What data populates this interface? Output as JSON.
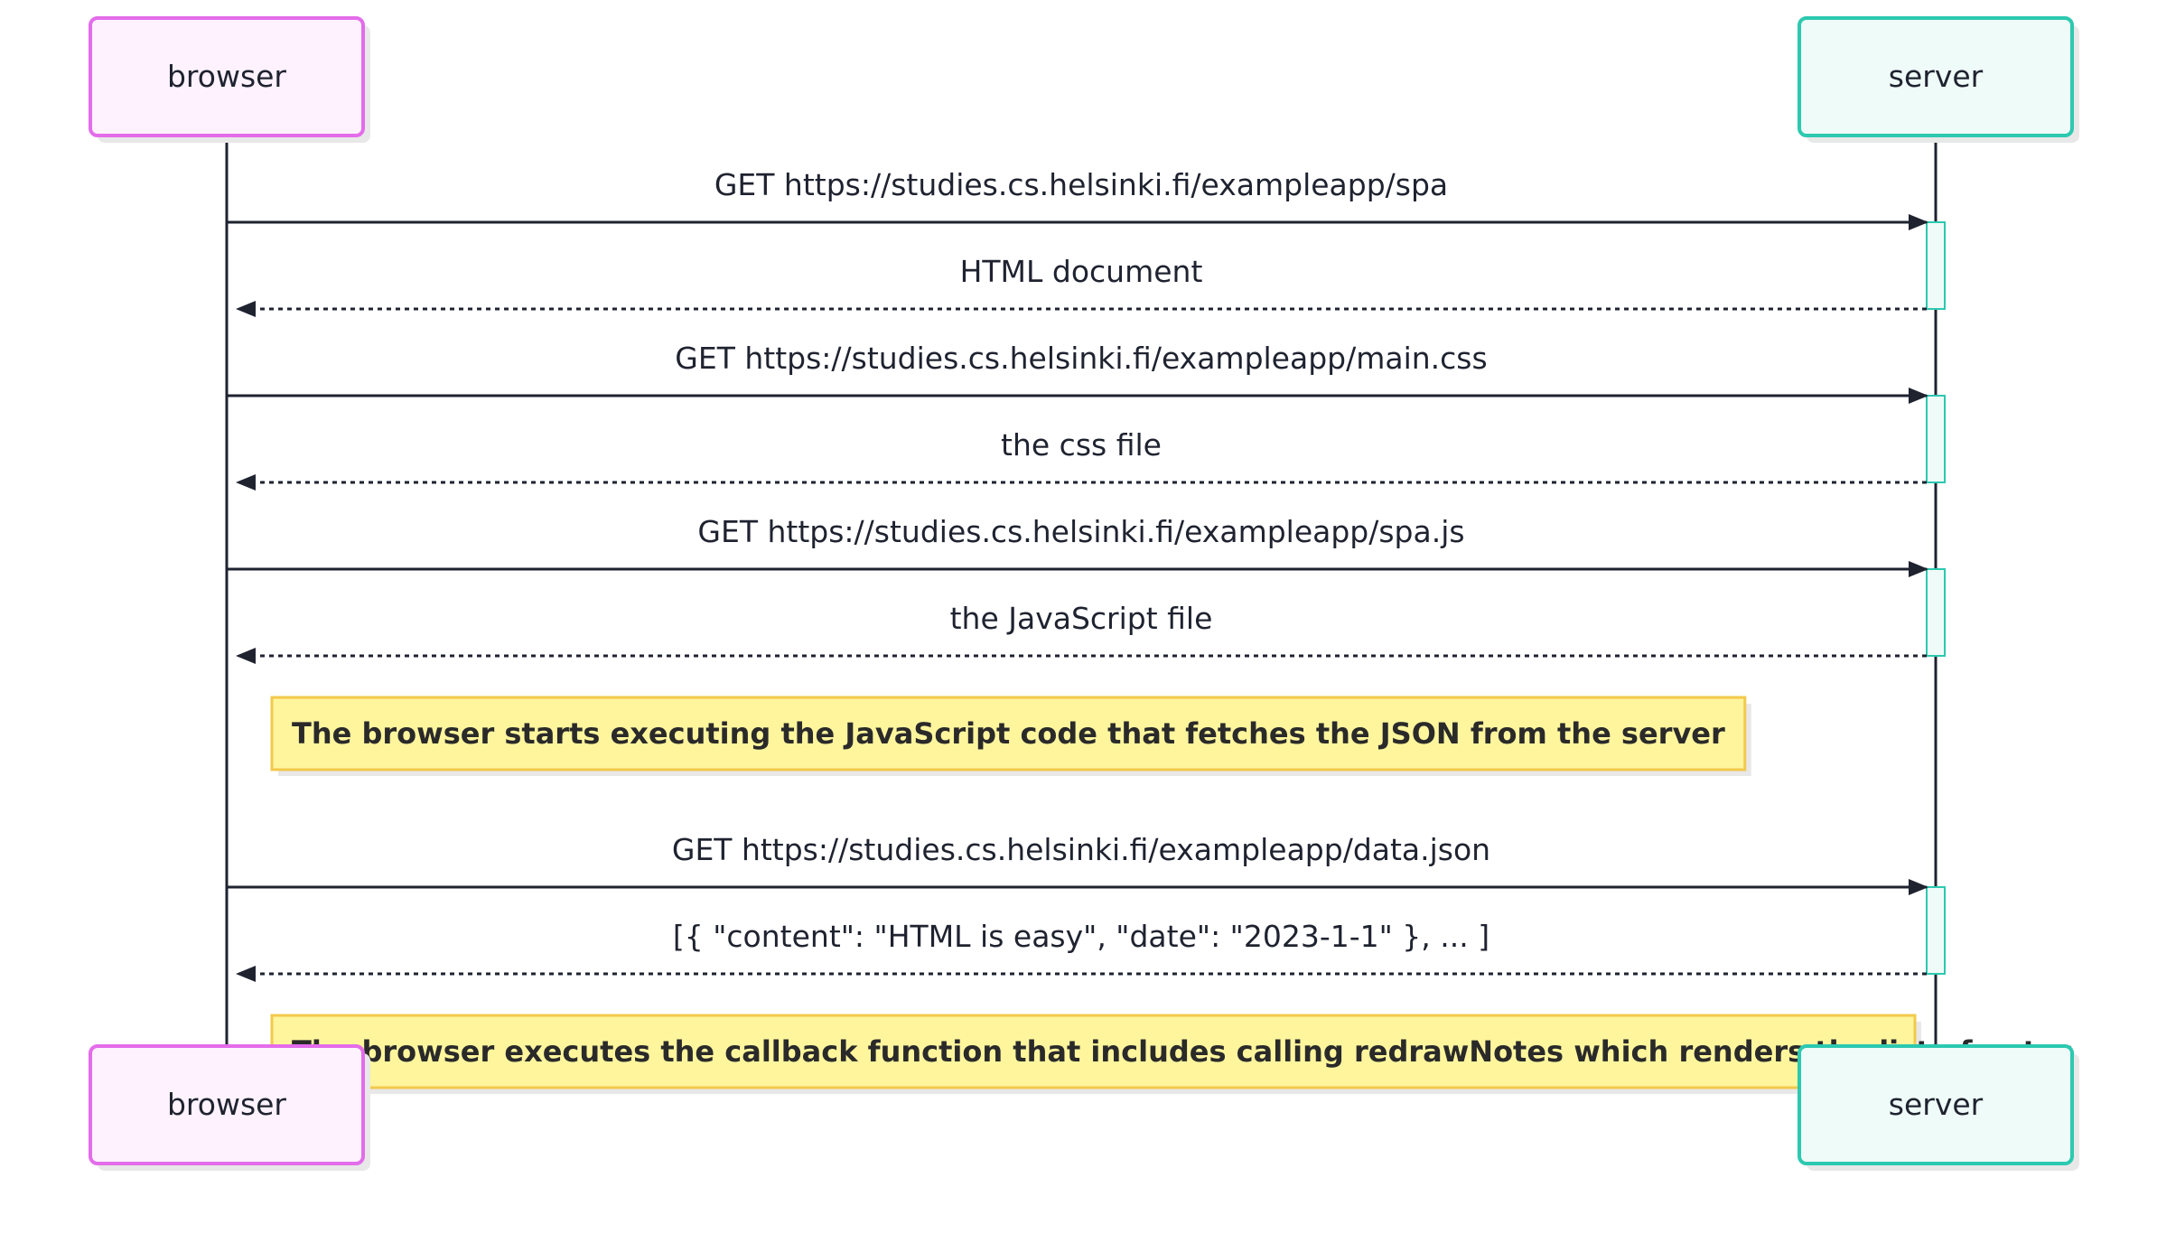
{
  "participants": [
    {
      "id": "browser",
      "label": "browser",
      "stroke": "#e36cea",
      "fill": "#fdf2fd"
    },
    {
      "id": "server",
      "label": "server",
      "stroke": "#2cc9b0",
      "fill": "#effbf8"
    }
  ],
  "steps": [
    {
      "kind": "message",
      "from": "browser",
      "to": "server",
      "style": "solid",
      "text": "GET https://studies.cs.helsinki.fi/exampleapp/spa"
    },
    {
      "kind": "message",
      "from": "server",
      "to": "browser",
      "style": "dotted",
      "text": "HTML document"
    },
    {
      "kind": "message",
      "from": "browser",
      "to": "server",
      "style": "solid",
      "text": "GET https://studies.cs.helsinki.fi/exampleapp/main.css"
    },
    {
      "kind": "message",
      "from": "server",
      "to": "browser",
      "style": "dotted",
      "text": "the css file"
    },
    {
      "kind": "message",
      "from": "browser",
      "to": "server",
      "style": "solid",
      "text": "GET https://studies.cs.helsinki.fi/exampleapp/spa.js"
    },
    {
      "kind": "message",
      "from": "server",
      "to": "browser",
      "style": "dotted",
      "text": "the JavaScript file"
    },
    {
      "kind": "note",
      "text": "The browser starts executing the JavaScript code that fetches the JSON from the server"
    },
    {
      "kind": "message",
      "from": "browser",
      "to": "server",
      "style": "solid",
      "text": "GET https://studies.cs.helsinki.fi/exampleapp/data.json"
    },
    {
      "kind": "message",
      "from": "server",
      "to": "browser",
      "style": "dotted",
      "text": "[{ \"content\": \"HTML is easy\", \"date\": \"2023-1-1\" }, ... ]"
    },
    {
      "kind": "note",
      "text": "The browser executes the callback function that includes calling redrawNotes which renders the list of notes"
    }
  ],
  "colors": {
    "line": "#1f2330",
    "activation_stroke": "#2cc9b0",
    "activation_fill": "#effbf8",
    "note_fill": "#fff59d",
    "note_stroke": "#f2c94c",
    "shadow": "#e8e8e8"
  }
}
